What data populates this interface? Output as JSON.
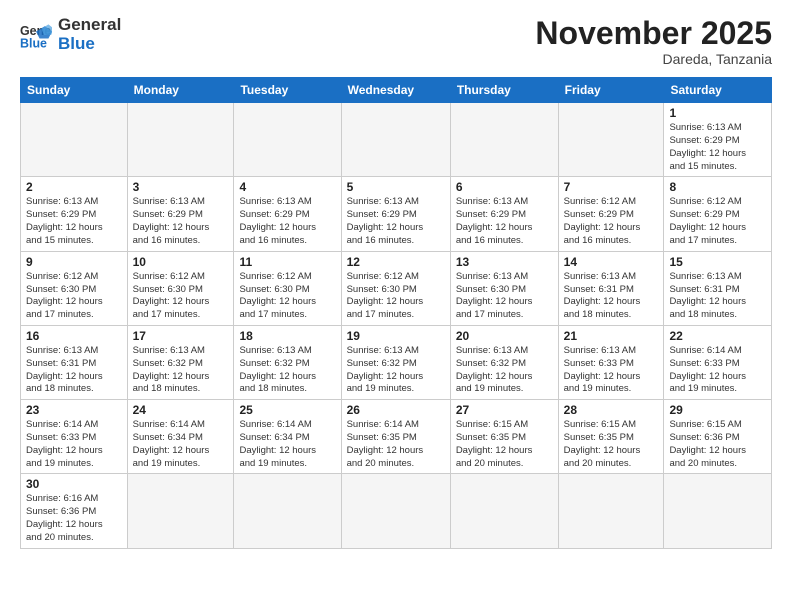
{
  "header": {
    "logo_general": "General",
    "logo_blue": "Blue",
    "month_title": "November 2025",
    "subtitle": "Dareda, Tanzania"
  },
  "weekdays": [
    "Sunday",
    "Monday",
    "Tuesday",
    "Wednesday",
    "Thursday",
    "Friday",
    "Saturday"
  ],
  "weeks": [
    [
      {
        "day": "",
        "info": ""
      },
      {
        "day": "",
        "info": ""
      },
      {
        "day": "",
        "info": ""
      },
      {
        "day": "",
        "info": ""
      },
      {
        "day": "",
        "info": ""
      },
      {
        "day": "",
        "info": ""
      },
      {
        "day": "1",
        "info": "Sunrise: 6:13 AM\nSunset: 6:29 PM\nDaylight: 12 hours\nand 15 minutes."
      }
    ],
    [
      {
        "day": "2",
        "info": "Sunrise: 6:13 AM\nSunset: 6:29 PM\nDaylight: 12 hours\nand 15 minutes."
      },
      {
        "day": "3",
        "info": "Sunrise: 6:13 AM\nSunset: 6:29 PM\nDaylight: 12 hours\nand 16 minutes."
      },
      {
        "day": "4",
        "info": "Sunrise: 6:13 AM\nSunset: 6:29 PM\nDaylight: 12 hours\nand 16 minutes."
      },
      {
        "day": "5",
        "info": "Sunrise: 6:13 AM\nSunset: 6:29 PM\nDaylight: 12 hours\nand 16 minutes."
      },
      {
        "day": "6",
        "info": "Sunrise: 6:13 AM\nSunset: 6:29 PM\nDaylight: 12 hours\nand 16 minutes."
      },
      {
        "day": "7",
        "info": "Sunrise: 6:12 AM\nSunset: 6:29 PM\nDaylight: 12 hours\nand 16 minutes."
      },
      {
        "day": "8",
        "info": "Sunrise: 6:12 AM\nSunset: 6:29 PM\nDaylight: 12 hours\nand 17 minutes."
      }
    ],
    [
      {
        "day": "9",
        "info": "Sunrise: 6:12 AM\nSunset: 6:30 PM\nDaylight: 12 hours\nand 17 minutes."
      },
      {
        "day": "10",
        "info": "Sunrise: 6:12 AM\nSunset: 6:30 PM\nDaylight: 12 hours\nand 17 minutes."
      },
      {
        "day": "11",
        "info": "Sunrise: 6:12 AM\nSunset: 6:30 PM\nDaylight: 12 hours\nand 17 minutes."
      },
      {
        "day": "12",
        "info": "Sunrise: 6:12 AM\nSunset: 6:30 PM\nDaylight: 12 hours\nand 17 minutes."
      },
      {
        "day": "13",
        "info": "Sunrise: 6:13 AM\nSunset: 6:30 PM\nDaylight: 12 hours\nand 17 minutes."
      },
      {
        "day": "14",
        "info": "Sunrise: 6:13 AM\nSunset: 6:31 PM\nDaylight: 12 hours\nand 18 minutes."
      },
      {
        "day": "15",
        "info": "Sunrise: 6:13 AM\nSunset: 6:31 PM\nDaylight: 12 hours\nand 18 minutes."
      }
    ],
    [
      {
        "day": "16",
        "info": "Sunrise: 6:13 AM\nSunset: 6:31 PM\nDaylight: 12 hours\nand 18 minutes."
      },
      {
        "day": "17",
        "info": "Sunrise: 6:13 AM\nSunset: 6:32 PM\nDaylight: 12 hours\nand 18 minutes."
      },
      {
        "day": "18",
        "info": "Sunrise: 6:13 AM\nSunset: 6:32 PM\nDaylight: 12 hours\nand 18 minutes."
      },
      {
        "day": "19",
        "info": "Sunrise: 6:13 AM\nSunset: 6:32 PM\nDaylight: 12 hours\nand 19 minutes."
      },
      {
        "day": "20",
        "info": "Sunrise: 6:13 AM\nSunset: 6:32 PM\nDaylight: 12 hours\nand 19 minutes."
      },
      {
        "day": "21",
        "info": "Sunrise: 6:13 AM\nSunset: 6:33 PM\nDaylight: 12 hours\nand 19 minutes."
      },
      {
        "day": "22",
        "info": "Sunrise: 6:14 AM\nSunset: 6:33 PM\nDaylight: 12 hours\nand 19 minutes."
      }
    ],
    [
      {
        "day": "23",
        "info": "Sunrise: 6:14 AM\nSunset: 6:33 PM\nDaylight: 12 hours\nand 19 minutes."
      },
      {
        "day": "24",
        "info": "Sunrise: 6:14 AM\nSunset: 6:34 PM\nDaylight: 12 hours\nand 19 minutes."
      },
      {
        "day": "25",
        "info": "Sunrise: 6:14 AM\nSunset: 6:34 PM\nDaylight: 12 hours\nand 19 minutes."
      },
      {
        "day": "26",
        "info": "Sunrise: 6:14 AM\nSunset: 6:35 PM\nDaylight: 12 hours\nand 20 minutes."
      },
      {
        "day": "27",
        "info": "Sunrise: 6:15 AM\nSunset: 6:35 PM\nDaylight: 12 hours\nand 20 minutes."
      },
      {
        "day": "28",
        "info": "Sunrise: 6:15 AM\nSunset: 6:35 PM\nDaylight: 12 hours\nand 20 minutes."
      },
      {
        "day": "29",
        "info": "Sunrise: 6:15 AM\nSunset: 6:36 PM\nDaylight: 12 hours\nand 20 minutes."
      }
    ],
    [
      {
        "day": "30",
        "info": "Sunrise: 6:16 AM\nSunset: 6:36 PM\nDaylight: 12 hours\nand 20 minutes."
      },
      {
        "day": "",
        "info": ""
      },
      {
        "day": "",
        "info": ""
      },
      {
        "day": "",
        "info": ""
      },
      {
        "day": "",
        "info": ""
      },
      {
        "day": "",
        "info": ""
      },
      {
        "day": "",
        "info": ""
      }
    ]
  ]
}
